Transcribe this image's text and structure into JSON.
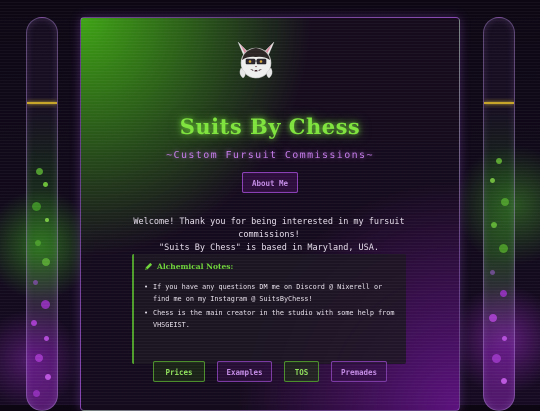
{
  "site": {
    "title": "Suits By Chess",
    "subtitle": "~Custom Fursuit Commissions~",
    "logo_icon": "bat-fursuit-head-logo"
  },
  "about_button": {
    "label": "About Me"
  },
  "welcome": {
    "line1": "Welcome! Thank you for being interested in my fursuit commissions!",
    "line2": "\"Suits By Chess\" is based in Maryland, USA."
  },
  "notes": {
    "icon": "pencil-icon",
    "title": "Alchemical Notes:",
    "items": [
      "If you have any questions DM me on Discord @ Nixerell or find me on my Instagram @ SuitsByChess!",
      "Chess is the main creator in the studio with some help from VHSGEIST."
    ]
  },
  "nav": {
    "prices": "Prices",
    "examples": "Examples",
    "tos": "TOS",
    "premades": "Premades"
  },
  "colors": {
    "accent_green": "#7fe33d",
    "accent_purple": "#c47be8",
    "tube_line": "#c7a52a",
    "background": "#0c0612"
  }
}
